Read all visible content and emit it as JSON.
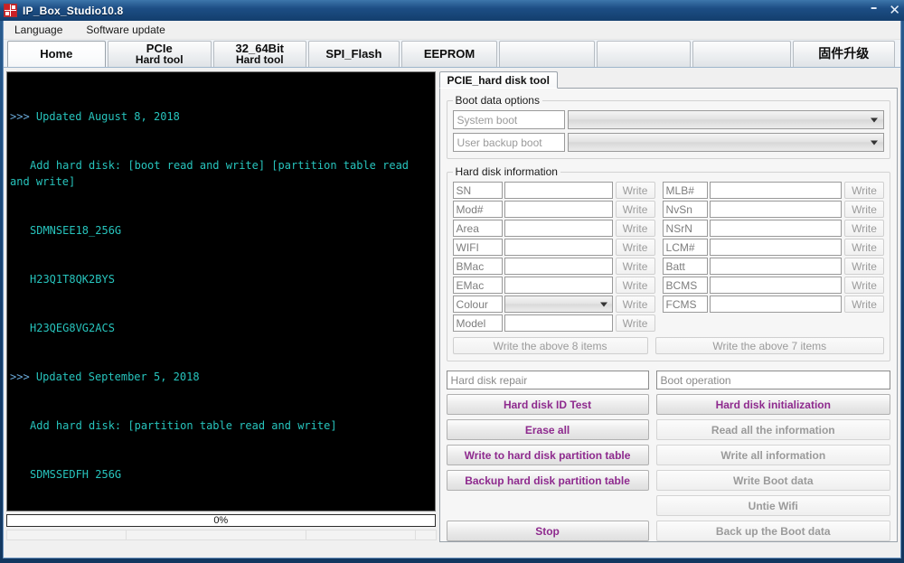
{
  "window": {
    "title": "IP_Box_Studio10.8",
    "minimize_label": "–",
    "close_label": "✕"
  },
  "menu": {
    "items": [
      {
        "label": "Language"
      },
      {
        "label": "Software update"
      }
    ]
  },
  "top_tabs": [
    {
      "line1": "Home",
      "line2": "",
      "selected": true
    },
    {
      "line1": "PCIe",
      "line2": "Hard tool",
      "selected": false
    },
    {
      "line1": "32_64Bit",
      "line2": "Hard tool",
      "selected": false
    },
    {
      "line1": "SPI_Flash",
      "line2": "",
      "selected": false
    },
    {
      "line1": "EEPROM",
      "line2": "",
      "selected": false
    },
    {
      "line1": "",
      "line2": "",
      "selected": false
    },
    {
      "line1": "",
      "line2": "",
      "selected": false
    },
    {
      "line1": "",
      "line2": "",
      "selected": false
    },
    {
      "line1": "固件升级",
      "line2": "",
      "selected": false
    }
  ],
  "console": {
    "lines": [
      {
        "marker": ">>>",
        "text": "Updated August 8, 2018"
      },
      {
        "marker": "",
        "text": "Add hard disk: [boot read and write] [partition table read and write]"
      },
      {
        "marker": "",
        "text": "SDMNSEE18_256G"
      },
      {
        "marker": "",
        "text": "H23Q1T8QK2BYS"
      },
      {
        "marker": "",
        "text": "H23QEG8VG2ACS"
      },
      {
        "marker": ">>>",
        "text": "Updated September 5, 2018"
      },
      {
        "marker": "",
        "text": "Add hard disk: [partition table read and write]"
      },
      {
        "marker": "",
        "text": "SDMSSEDFH 256G"
      }
    ]
  },
  "progress": {
    "label": "0%",
    "value": 0
  },
  "statusbar": {
    "cells": [
      "",
      "",
      "",
      ""
    ]
  },
  "inner_tab": {
    "label": "PCIE_hard disk tool"
  },
  "boot_data_options": {
    "legend": "Boot data options",
    "rows": [
      {
        "label": "System boot",
        "value": ""
      },
      {
        "label": "User backup boot",
        "value": ""
      }
    ]
  },
  "hard_disk_information": {
    "legend": "Hard disk information",
    "write_label": "Write",
    "left_fields": [
      {
        "name": "SN",
        "value": "",
        "type": "text"
      },
      {
        "name": "Mod#",
        "value": "",
        "type": "text"
      },
      {
        "name": "Area",
        "value": "",
        "type": "text"
      },
      {
        "name": "WIFI",
        "value": "",
        "type": "text"
      },
      {
        "name": "BMac",
        "value": "",
        "type": "text"
      },
      {
        "name": "EMac",
        "value": "",
        "type": "text"
      },
      {
        "name": "Colour",
        "value": "",
        "type": "combo"
      },
      {
        "name": "Model",
        "value": "",
        "type": "text"
      }
    ],
    "right_fields": [
      {
        "name": "MLB#",
        "value": "",
        "type": "text"
      },
      {
        "name": "NvSn",
        "value": "",
        "type": "text"
      },
      {
        "name": "NSrN",
        "value": "",
        "type": "text"
      },
      {
        "name": "LCM#",
        "value": "",
        "type": "text"
      },
      {
        "name": "Batt",
        "value": "",
        "type": "text"
      },
      {
        "name": "BCMS",
        "value": "",
        "type": "text"
      },
      {
        "name": "FCMS",
        "value": "",
        "type": "text"
      }
    ],
    "bulk_left_label": "Write the above 8 items",
    "bulk_right_label": "Write the above 7 items"
  },
  "operations": {
    "left_header": "Hard disk repair",
    "right_header": "Boot operation",
    "left_buttons": [
      {
        "label": "Hard disk ID Test",
        "state": "active"
      },
      {
        "label": "Erase all",
        "state": "active"
      },
      {
        "label": "Write to hard disk partition table",
        "state": "active"
      },
      {
        "label": "Backup hard disk partition table",
        "state": "active"
      },
      {
        "label": "",
        "state": "spacer"
      },
      {
        "label": "Stop",
        "state": "active"
      }
    ],
    "right_buttons": [
      {
        "label": "Hard disk initialization",
        "state": "active"
      },
      {
        "label": "Read all the information",
        "state": "dim"
      },
      {
        "label": "Write all information",
        "state": "dim"
      },
      {
        "label": "Write Boot data",
        "state": "dim"
      },
      {
        "label": "Untie Wifi",
        "state": "dim"
      },
      {
        "label": "Back up the Boot data",
        "state": "dim"
      }
    ]
  },
  "colors": {
    "titlebar": "#1d4e85",
    "console_bg": "#000000",
    "console_text": "#27c4bd",
    "console_marker": "#6aa9d8",
    "button_accent": "#8e2a8e",
    "button_dim": "#9a9a9a"
  }
}
